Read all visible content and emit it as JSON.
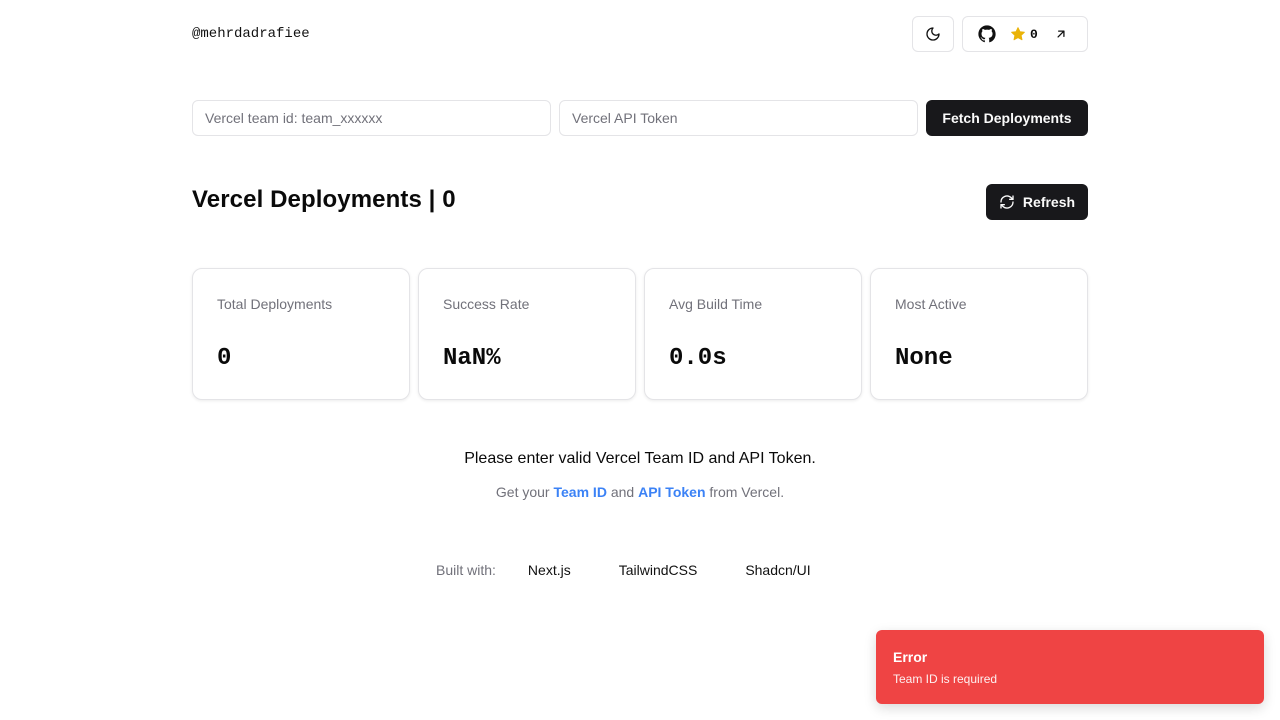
{
  "header": {
    "username": "@mehrdadrafiee",
    "star_count": "0"
  },
  "form": {
    "team_placeholder": "Vercel team id: team_xxxxxx",
    "team_value": "",
    "token_placeholder": "Vercel API Token",
    "token_value": "",
    "fetch_label": "Fetch Deployments"
  },
  "main": {
    "title": "Vercel Deployments | 0",
    "refresh_label": "Refresh"
  },
  "stats": [
    {
      "label": "Total Deployments",
      "value": "0"
    },
    {
      "label": "Success Rate",
      "value": "NaN%"
    },
    {
      "label": "Avg Build Time",
      "value": "0.0s"
    },
    {
      "label": "Most Active",
      "value": "None"
    }
  ],
  "message": {
    "main": "Please enter valid Vercel Team ID and API Token.",
    "sub_prefix": "Get your",
    "team_link": "Team ID",
    "sub_and": "and",
    "token_link": "API Token",
    "sub_suffix": "from Vercel."
  },
  "footer": {
    "label": "Built with:",
    "tech": [
      "Next.js",
      "TailwindCSS",
      "Shadcn/UI"
    ]
  },
  "toast": {
    "title": "Error",
    "description": "Team ID is required"
  },
  "colors": {
    "primary": "#18181b",
    "error": "#ef4444",
    "link": "#3b82f6",
    "star": "#eab308"
  },
  "icons": [
    "moon-icon",
    "github-icon",
    "star-icon",
    "arrow-up-right-icon",
    "refresh-icon"
  ]
}
